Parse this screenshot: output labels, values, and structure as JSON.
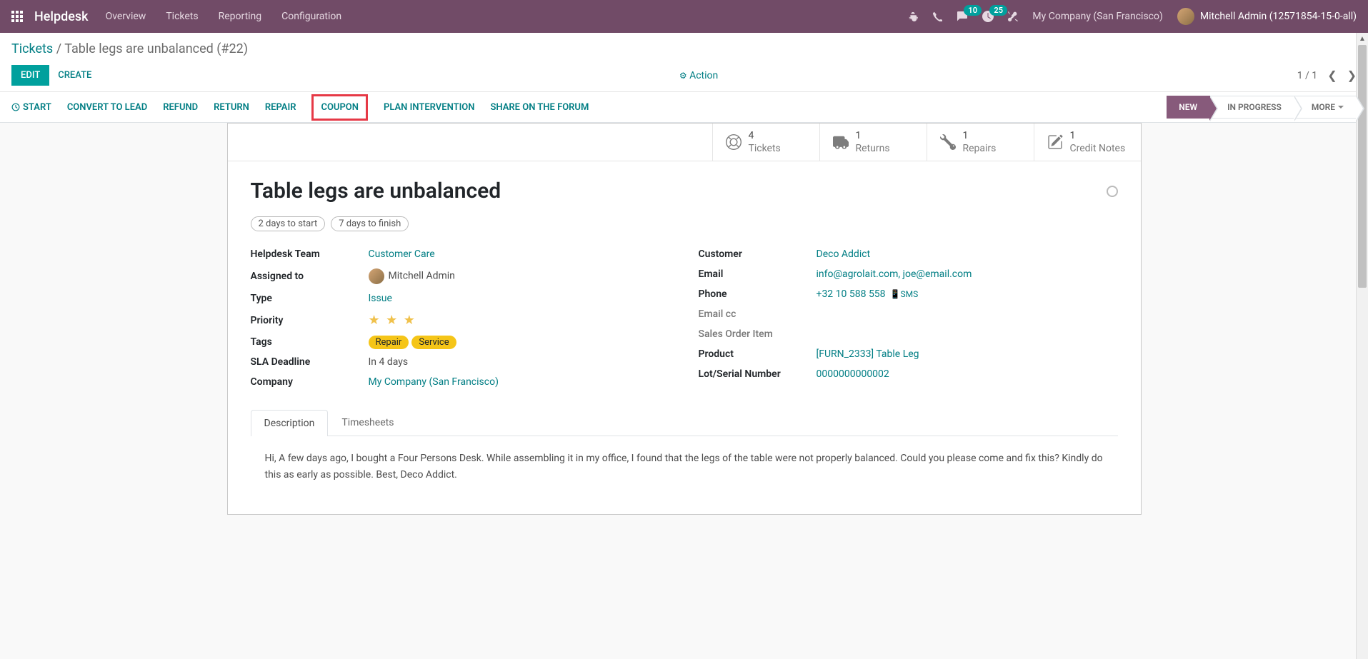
{
  "navbar": {
    "brand": "Helpdesk",
    "links": [
      "Overview",
      "Tickets",
      "Reporting",
      "Configuration"
    ],
    "messages_badge": "10",
    "activities_badge": "25",
    "company": "My Company (San Francisco)",
    "user": "Mitchell Admin (12571854-15-0-all)"
  },
  "breadcrumb": {
    "root": "Tickets",
    "current": "Table legs are unbalanced (#22)"
  },
  "buttons": {
    "edit": "EDIT",
    "create": "CREATE",
    "action": "Action"
  },
  "pager": {
    "text": "1 / 1"
  },
  "status_actions": [
    "START",
    "CONVERT TO LEAD",
    "REFUND",
    "RETURN",
    "REPAIR",
    "COUPON",
    "PLAN INTERVENTION",
    "SHARE ON THE FORUM"
  ],
  "stages": {
    "new": "NEW",
    "in_progress": "IN PROGRESS",
    "more": "MORE"
  },
  "stats": {
    "tickets": {
      "n": "4",
      "label": "Tickets"
    },
    "returns": {
      "n": "1",
      "label": "Returns"
    },
    "repairs": {
      "n": "1",
      "label": "Repairs"
    },
    "credit": {
      "n": "1",
      "label": "Credit Notes"
    }
  },
  "ticket": {
    "title": "Table legs are unbalanced",
    "time_to_start": "2 days to start",
    "time_to_finish": "7 days to finish",
    "labels": {
      "team": "Helpdesk Team",
      "assigned": "Assigned to",
      "type": "Type",
      "priority": "Priority",
      "tags": "Tags",
      "sla": "SLA Deadline",
      "company": "Company",
      "customer": "Customer",
      "email": "Email",
      "phone": "Phone",
      "email_cc": "Email cc",
      "sale_item": "Sales Order Item",
      "product": "Product",
      "lot": "Lot/Serial Number"
    },
    "team": "Customer Care",
    "assigned": "Mitchell Admin",
    "type": "Issue",
    "tags": [
      "Repair",
      "Service"
    ],
    "sla": "In 4 days",
    "company": "My Company (San Francisco)",
    "customer": "Deco Addict",
    "email": "info@agrolait.com, joe@email.com",
    "phone": "+32 10 588 558",
    "sms": "SMS",
    "product": "[FURN_2333] Table Leg",
    "lot": "0000000000002"
  },
  "tabs": {
    "description": "Description",
    "timesheets": "Timesheets"
  },
  "description_text": "Hi, A few days ago, I bought a Four Persons Desk. While assembling it in my office, I found that the legs of the table were not properly balanced. Could you please come and fix this? Kindly do this as early as possible. Best, Deco Addict."
}
